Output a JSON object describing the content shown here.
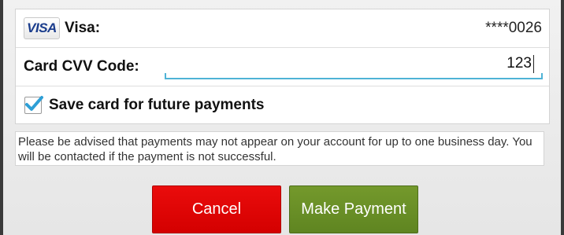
{
  "payment_card": {
    "brand_logo": "VISA",
    "card_label": "Visa:",
    "masked_number": "****0026"
  },
  "cvv": {
    "label": "Card CVV Code:",
    "value": "123"
  },
  "save_card": {
    "label": "Save card for future payments",
    "checked": true,
    "icon": "checkmark-icon"
  },
  "notice": {
    "text": "Please be advised that payments may not appear on your account for up to one business day. You will be contacted if the payment is not successful."
  },
  "actions": {
    "cancel_label": "Cancel",
    "pay_label": "Make Payment"
  },
  "colors": {
    "cancel_button": "#d90000",
    "pay_button": "#6a8f27",
    "input_accent": "#4fb3d6",
    "checkbox_check": "#2e9fd6"
  }
}
